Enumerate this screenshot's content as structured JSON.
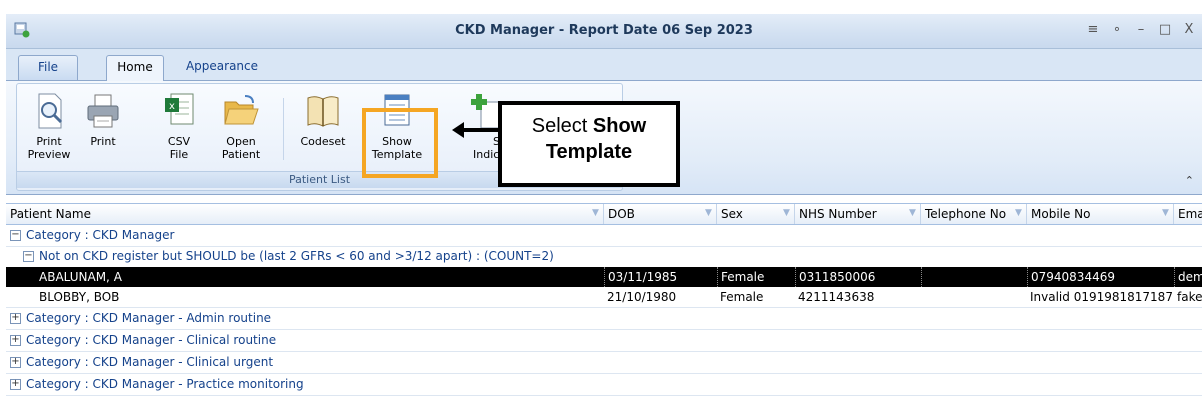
{
  "window": {
    "title": "CKD Manager - Report Date 06 Sep 2023",
    "controls": [
      "≡",
      "∘",
      "–",
      "□",
      "X"
    ]
  },
  "tabs": {
    "file": "File",
    "home": "Home",
    "appearance": "Appearance"
  },
  "ribbon": {
    "group_label": "Patient List",
    "buttons": {
      "print_preview": {
        "line1": "Print",
        "line2": "Preview"
      },
      "print": {
        "line1": "Print",
        "line2": ""
      },
      "csv": {
        "line1": "CSV",
        "line2": "File"
      },
      "open_patient": {
        "line1": "Open",
        "line2": "Patient"
      },
      "codeset": {
        "line1": "Codeset",
        "line2": ""
      },
      "show_template": {
        "line1": "Show",
        "line2": "Template"
      },
      "show_indicators": {
        "line1": "Sho",
        "line2": "Indica"
      }
    }
  },
  "callout": {
    "prefix": "Select ",
    "bold": "Show Template"
  },
  "columns": {
    "patient_name": "Patient Name",
    "dob": "DOB",
    "sex": "Sex",
    "nhs": "NHS Number",
    "telephone": "Telephone No",
    "mobile": "Mobile No",
    "email": "Ema"
  },
  "groups": {
    "ckd": "Category : CKD Manager",
    "sub": "Not on CKD register but SHOULD be (last 2 GFRs < 60 and >3/12 apart) : (COUNT=2)",
    "admin": "Category : CKD Manager - Admin routine",
    "clinical_routine": "Category : CKD Manager - Clinical routine",
    "clinical_urgent": "Category : CKD Manager - Clinical urgent",
    "practice": "Category : CKD Manager - Practice monitoring"
  },
  "patients": [
    {
      "name": "ABALUNAM, A",
      "dob": "03/11/1985",
      "sex": "Female",
      "nhs": "0311850006",
      "telephone": "",
      "mobile": "07940834469",
      "email": "dem"
    },
    {
      "name": "BLOBBY, BOB",
      "dob": "21/10/1980",
      "sex": "Female",
      "nhs": "4211143638",
      "telephone": "",
      "mobile": "Invalid 0191981817187",
      "email": "fake"
    }
  ],
  "colors": {
    "highlight": "#f5a623",
    "link_text": "#15428b"
  }
}
